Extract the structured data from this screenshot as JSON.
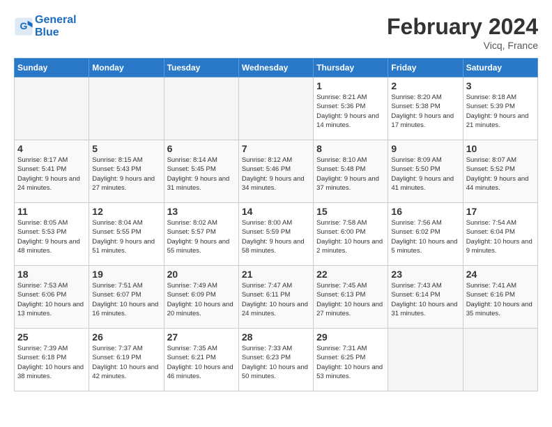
{
  "header": {
    "logo_line1": "General",
    "logo_line2": "Blue",
    "month_year": "February 2024",
    "location": "Vicq, France"
  },
  "days_of_week": [
    "Sunday",
    "Monday",
    "Tuesday",
    "Wednesday",
    "Thursday",
    "Friday",
    "Saturday"
  ],
  "weeks": [
    [
      {
        "num": "",
        "empty": true
      },
      {
        "num": "",
        "empty": true
      },
      {
        "num": "",
        "empty": true
      },
      {
        "num": "",
        "empty": true
      },
      {
        "num": "1",
        "sunrise": "8:21 AM",
        "sunset": "5:36 PM",
        "daylight": "9 hours and 14 minutes."
      },
      {
        "num": "2",
        "sunrise": "8:20 AM",
        "sunset": "5:38 PM",
        "daylight": "9 hours and 17 minutes."
      },
      {
        "num": "3",
        "sunrise": "8:18 AM",
        "sunset": "5:39 PM",
        "daylight": "9 hours and 21 minutes."
      }
    ],
    [
      {
        "num": "4",
        "sunrise": "8:17 AM",
        "sunset": "5:41 PM",
        "daylight": "9 hours and 24 minutes."
      },
      {
        "num": "5",
        "sunrise": "8:15 AM",
        "sunset": "5:43 PM",
        "daylight": "9 hours and 27 minutes."
      },
      {
        "num": "6",
        "sunrise": "8:14 AM",
        "sunset": "5:45 PM",
        "daylight": "9 hours and 31 minutes."
      },
      {
        "num": "7",
        "sunrise": "8:12 AM",
        "sunset": "5:46 PM",
        "daylight": "9 hours and 34 minutes."
      },
      {
        "num": "8",
        "sunrise": "8:10 AM",
        "sunset": "5:48 PM",
        "daylight": "9 hours and 37 minutes."
      },
      {
        "num": "9",
        "sunrise": "8:09 AM",
        "sunset": "5:50 PM",
        "daylight": "9 hours and 41 minutes."
      },
      {
        "num": "10",
        "sunrise": "8:07 AM",
        "sunset": "5:52 PM",
        "daylight": "9 hours and 44 minutes."
      }
    ],
    [
      {
        "num": "11",
        "sunrise": "8:05 AM",
        "sunset": "5:53 PM",
        "daylight": "9 hours and 48 minutes."
      },
      {
        "num": "12",
        "sunrise": "8:04 AM",
        "sunset": "5:55 PM",
        "daylight": "9 hours and 51 minutes."
      },
      {
        "num": "13",
        "sunrise": "8:02 AM",
        "sunset": "5:57 PM",
        "daylight": "9 hours and 55 minutes."
      },
      {
        "num": "14",
        "sunrise": "8:00 AM",
        "sunset": "5:59 PM",
        "daylight": "9 hours and 58 minutes."
      },
      {
        "num": "15",
        "sunrise": "7:58 AM",
        "sunset": "6:00 PM",
        "daylight": "10 hours and 2 minutes."
      },
      {
        "num": "16",
        "sunrise": "7:56 AM",
        "sunset": "6:02 PM",
        "daylight": "10 hours and 5 minutes."
      },
      {
        "num": "17",
        "sunrise": "7:54 AM",
        "sunset": "6:04 PM",
        "daylight": "10 hours and 9 minutes."
      }
    ],
    [
      {
        "num": "18",
        "sunrise": "7:53 AM",
        "sunset": "6:06 PM",
        "daylight": "10 hours and 13 minutes."
      },
      {
        "num": "19",
        "sunrise": "7:51 AM",
        "sunset": "6:07 PM",
        "daylight": "10 hours and 16 minutes."
      },
      {
        "num": "20",
        "sunrise": "7:49 AM",
        "sunset": "6:09 PM",
        "daylight": "10 hours and 20 minutes."
      },
      {
        "num": "21",
        "sunrise": "7:47 AM",
        "sunset": "6:11 PM",
        "daylight": "10 hours and 24 minutes."
      },
      {
        "num": "22",
        "sunrise": "7:45 AM",
        "sunset": "6:13 PM",
        "daylight": "10 hours and 27 minutes."
      },
      {
        "num": "23",
        "sunrise": "7:43 AM",
        "sunset": "6:14 PM",
        "daylight": "10 hours and 31 minutes."
      },
      {
        "num": "24",
        "sunrise": "7:41 AM",
        "sunset": "6:16 PM",
        "daylight": "10 hours and 35 minutes."
      }
    ],
    [
      {
        "num": "25",
        "sunrise": "7:39 AM",
        "sunset": "6:18 PM",
        "daylight": "10 hours and 38 minutes."
      },
      {
        "num": "26",
        "sunrise": "7:37 AM",
        "sunset": "6:19 PM",
        "daylight": "10 hours and 42 minutes."
      },
      {
        "num": "27",
        "sunrise": "7:35 AM",
        "sunset": "6:21 PM",
        "daylight": "10 hours and 46 minutes."
      },
      {
        "num": "28",
        "sunrise": "7:33 AM",
        "sunset": "6:23 PM",
        "daylight": "10 hours and 50 minutes."
      },
      {
        "num": "29",
        "sunrise": "7:31 AM",
        "sunset": "6:25 PM",
        "daylight": "10 hours and 53 minutes."
      },
      {
        "num": "",
        "empty": true
      },
      {
        "num": "",
        "empty": true
      }
    ]
  ]
}
